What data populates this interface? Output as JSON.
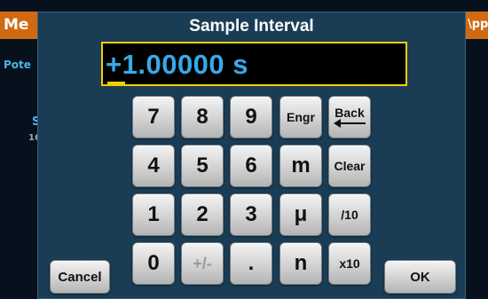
{
  "background_app": {
    "title_left": "Me",
    "title_right": "\\pp",
    "side_label": "Pote",
    "side_s": "S",
    "side_16": "16"
  },
  "dialog": {
    "title": "Sample Interval",
    "value": "+1.00000 s"
  },
  "keypad": {
    "rows": [
      [
        "7",
        "8",
        "9",
        "Engr",
        "Back"
      ],
      [
        "4",
        "5",
        "6",
        "m",
        "Clear"
      ],
      [
        "1",
        "2",
        "3",
        "μ",
        "/10"
      ],
      [
        "0",
        "+/-",
        ".",
        "n",
        "x10"
      ]
    ]
  },
  "buttons": {
    "cancel": "Cancel",
    "ok": "OK"
  },
  "colors": {
    "dialog_bg": "#1a3d55",
    "value_text": "#39a9e6",
    "field_border": "#f0d000",
    "title_bar": "#cf6a12"
  }
}
